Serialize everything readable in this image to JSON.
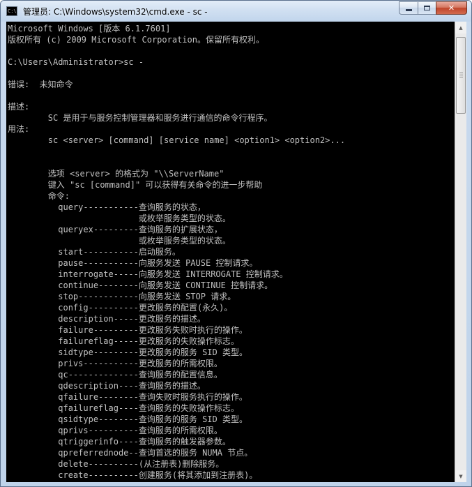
{
  "window": {
    "title": "管理员: C:\\Windows\\system32\\cmd.exe - sc  -",
    "icon_text": "C:\\",
    "icon": "console-app-icon",
    "controls": {
      "minimize": "minimize-icon",
      "maximize": "maximize-icon",
      "close_label": "✕"
    }
  },
  "colors": {
    "console_bg": "#000000",
    "console_fg": "#c0c0c0",
    "close_button": "#c7432b"
  },
  "console": {
    "lines": [
      "Microsoft Windows [版本 6.1.7601]",
      "版权所有 (c) 2009 Microsoft Corporation。保留所有权利。",
      "",
      "C:\\Users\\Administrator>sc -",
      "",
      "错误:  未知命令",
      "",
      "描述:",
      "        SC 是用于与服务控制管理器和服务进行通信的命令行程序。",
      "用法:",
      "        sc <server> [command] [service name] <option1> <option2>...",
      "",
      "",
      "        选项 <server> 的格式为 \"\\\\ServerName\"",
      "        键入 \"sc [command]\" 可以获得有关命令的进一步帮助",
      "        命令:",
      "          query-----------查询服务的状态，",
      "                          或枚举服务类型的状态。",
      "          queryex---------查询服务的扩展状态，",
      "                          或枚举服务类型的状态。",
      "          start-----------启动服务。",
      "          pause-----------向服务发送 PAUSE 控制请求。",
      "          interrogate-----向服务发送 INTERROGATE 控制请求。",
      "          continue--------向服务发送 CONTINUE 控制请求。",
      "          stop------------向服务发送 STOP 请求。",
      "          config----------更改服务的配置(永久)。",
      "          description-----更改服务的描述。",
      "          failure---------更改服务失败时执行的操作。",
      "          failureflag-----更改服务的失败操作标志。",
      "          sidtype---------更改服务的服务 SID 类型。",
      "          privs-----------更改服务的所需权限。",
      "          qc--------------查询服务的配置信息。",
      "          qdescription----查询服务的描述。",
      "          qfailure--------查询失败时服务执行的操作。",
      "          qfailureflag----查询服务的失败操作标志。",
      "          qsidtype--------查询服务的服务 SID 类型。",
      "          qprivs----------查询服务的所需权限。",
      "          qtriggerinfo----查询服务的触发器参数。",
      "          qpreferrednode--查询首选的服务 NUMA 节点。",
      "          delete----------(从注册表)删除服务。",
      "          create----------创建服务(将其添加到注册表)。"
    ]
  },
  "scrollbar": {
    "up_icon": "scroll-up-arrow-icon",
    "down_icon": "scroll-down-arrow-icon",
    "up_glyph": "▲",
    "down_glyph": "▼"
  }
}
